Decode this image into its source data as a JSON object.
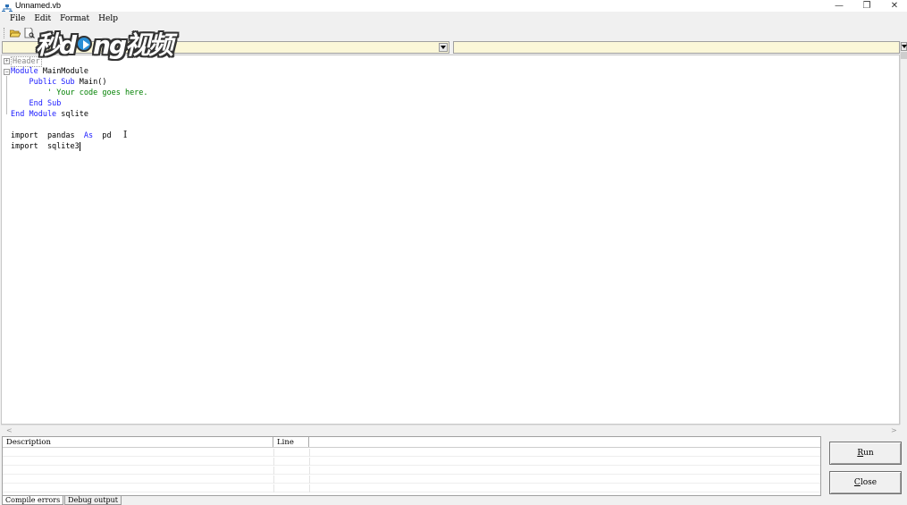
{
  "window": {
    "title": "Unnamed.vb",
    "minimize": "—",
    "maximize": "❐",
    "close": "✕"
  },
  "menu": [
    "File",
    "Edit",
    "Format",
    "Help"
  ],
  "watermark": {
    "text_before": "秒d",
    "text_after": "ng视频"
  },
  "editor": {
    "header_label": "Header",
    "lines": [
      {
        "kw1": "Module",
        "rest": " MainModule"
      },
      {
        "indent": "    ",
        "kw1": "Public Sub",
        "rest": " Main()"
      },
      {
        "indent": "        ",
        "comment": "' Your code goes here."
      },
      {
        "indent": "    ",
        "kw1": "End Sub"
      },
      {
        "kw1": "End Module",
        "rest": " sqlite"
      }
    ],
    "import1": {
      "pre": "import  pandas  ",
      "kw": "As",
      "post": "  pd"
    },
    "import2": "import  sqlite3"
  },
  "errors": {
    "columns": [
      "Description",
      "Line"
    ]
  },
  "tabs": [
    "Compile errors",
    "Debug output"
  ],
  "buttons": {
    "run_first": "R",
    "run_rest": "un",
    "close_first": "C",
    "close_rest": "lose"
  }
}
